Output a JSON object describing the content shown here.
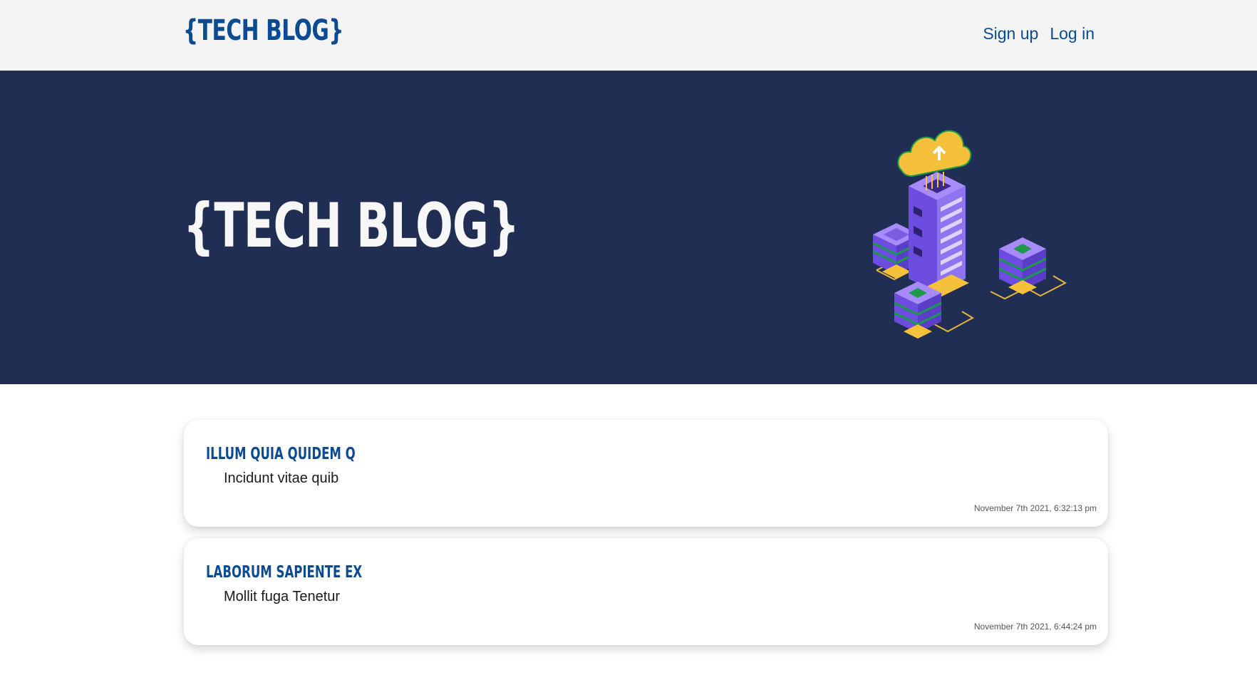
{
  "header": {
    "brand": "{TECH BLOG}",
    "nav": [
      {
        "label": "Sign up"
      },
      {
        "label": "Log in"
      }
    ]
  },
  "hero": {
    "title": "{TECH BLOG}",
    "illustration": "server-cloud-illustration"
  },
  "posts": [
    {
      "title": "ILLUM QUIA QUIDEM Q",
      "body": "Incidunt vitae quib",
      "date": "November 7th 2021, 6:32:13 pm"
    },
    {
      "title": "LABORUM SAPIENTE EX",
      "body": "Mollit fuga Tenetur",
      "date": "November 7th 2021, 6:44:24 pm"
    }
  ],
  "colors": {
    "navbar_bg": "#f4f4f4",
    "brand": "#0c4a94",
    "hero_bg": "#1f2e52",
    "hero_text": "#f7f7f7",
    "accent_purple": "#7b55e8",
    "accent_yellow": "#f5c13a",
    "accent_green": "#1b9a4a"
  }
}
